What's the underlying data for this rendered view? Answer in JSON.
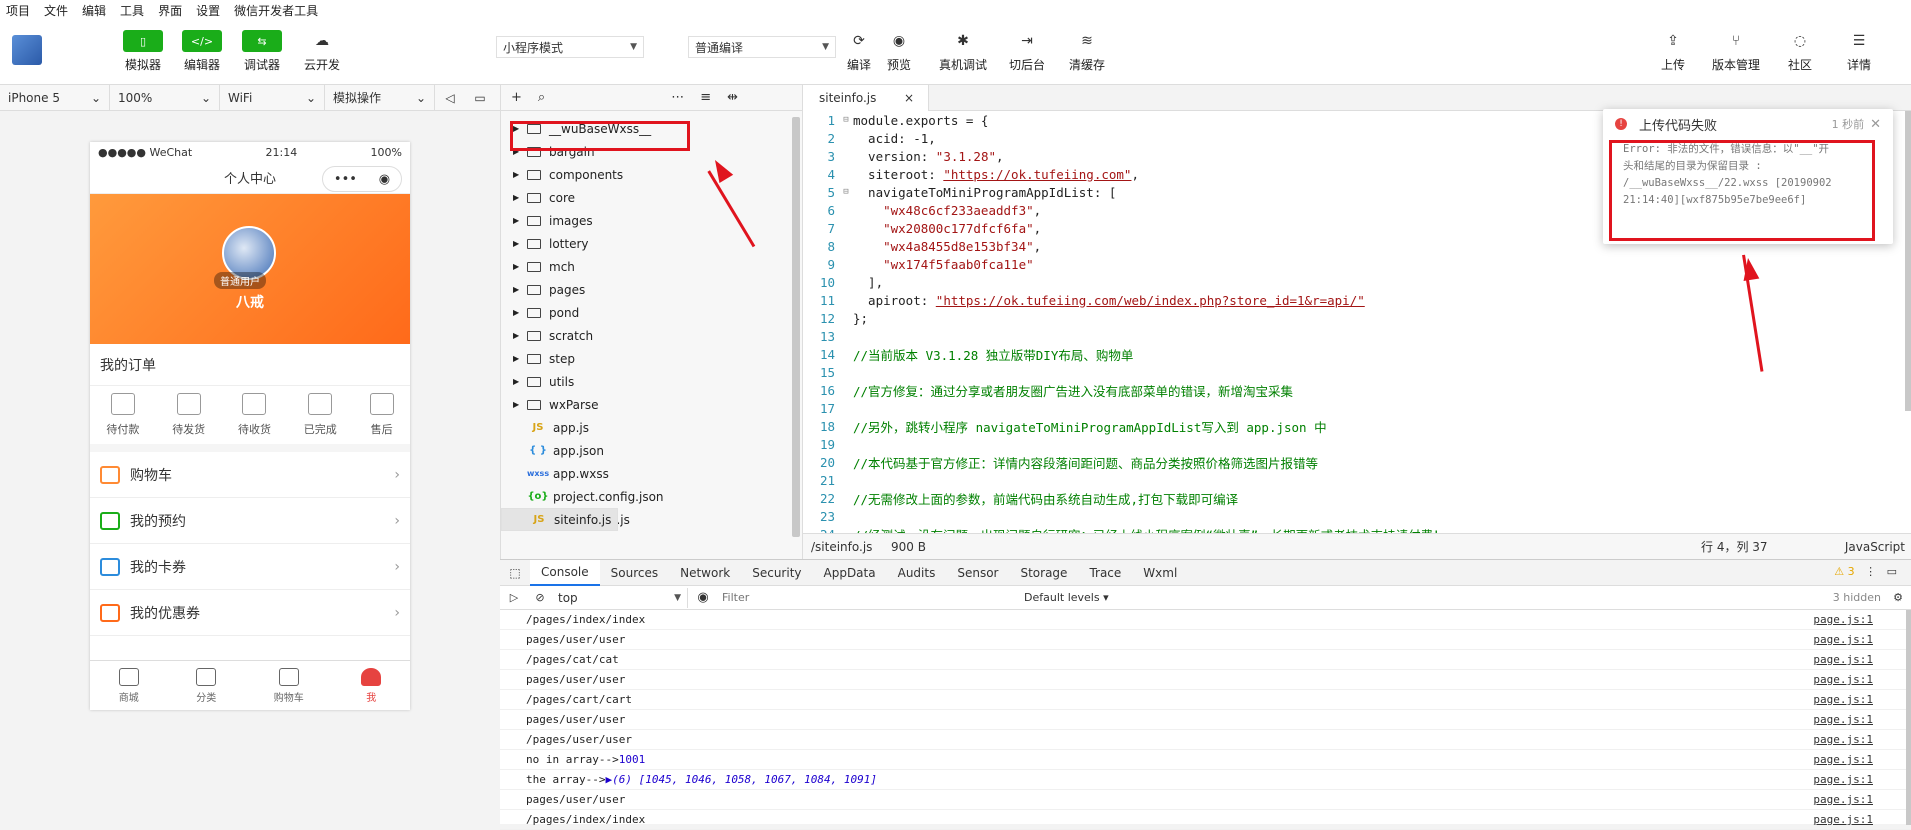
{
  "menubar": [
    "项目",
    "文件",
    "编辑",
    "工具",
    "界面",
    "设置",
    "微信开发者工具"
  ],
  "toolbar": {
    "simulator": "模拟器",
    "editor": "编辑器",
    "debugger": "调试器",
    "cloud": "云开发",
    "mode": "小程序模式",
    "compile_mode": "普通编译",
    "compile": "编译",
    "preview": "预览",
    "remote_debug": "真机调试",
    "background": "切后台",
    "clear_cache": "清缓存",
    "upload": "上传",
    "version": "版本管理",
    "community": "社区",
    "details": "详情"
  },
  "devbar": {
    "device": "iPhone 5",
    "zoom": "100%",
    "network": "WiFi",
    "action": "模拟操作"
  },
  "phone": {
    "carrier": "●●●●● WeChat",
    "time": "21:14",
    "battery": "100%",
    "nav_title": "个人中心",
    "capsule_dots": "•••",
    "capsule_close": "◉",
    "user_badge": "普通用户",
    "user_name": "八戒",
    "orders_title": "我的订单",
    "orders": [
      "待付款",
      "待发货",
      "待收货",
      "已完成",
      "售后"
    ],
    "list": [
      "购物车",
      "我的预约",
      "我的卡券",
      "我的优惠券"
    ],
    "tabs": [
      "商城",
      "分类",
      "购物车",
      "我"
    ]
  },
  "explorer": {
    "tools": [
      "+",
      "⌕",
      "⋯",
      "≡",
      "⇹"
    ],
    "folders": [
      "__wuBaseWxss__",
      "bargain",
      "components",
      "core",
      "images",
      "lottery",
      "mch",
      "pages",
      "pond",
      "scratch",
      "step",
      "utils",
      "wxParse"
    ],
    "files": [
      {
        "icon": "JS",
        "name": "app.js",
        "kind": "js"
      },
      {
        "icon": "{ }",
        "name": "app.json",
        "kind": "json"
      },
      {
        "icon": "wxss",
        "name": "app.wxss",
        "kind": "wxss"
      },
      {
        "icon": "{o}",
        "name": "project.config.json",
        "kind": "cfg"
      },
      {
        "icon": "JS",
        "name": "siteinfo.js",
        "kind": "js"
      },
      {
        "icon": "JS",
        "name": "siteinfo.tpl.js",
        "kind": "js"
      }
    ]
  },
  "editor": {
    "tab": "siteinfo.js",
    "tab_close": "×",
    "lines": [
      {
        "n": "1",
        "f": "⊟",
        "parts": [
          [
            "k",
            "module.exports = {"
          ]
        ]
      },
      {
        "n": "2",
        "f": "",
        "parts": [
          [
            "k",
            "  acid: -1,"
          ]
        ]
      },
      {
        "n": "3",
        "f": "",
        "parts": [
          [
            "k",
            "  version: "
          ],
          [
            "s",
            "\"3.1.28\""
          ],
          [
            "k",
            ","
          ]
        ]
      },
      {
        "n": "4",
        "f": "",
        "parts": [
          [
            "k",
            "  siteroot: "
          ],
          [
            "u",
            "\"https://ok.tufeiing.com\""
          ],
          [
            "k",
            ","
          ]
        ]
      },
      {
        "n": "5",
        "f": "⊟",
        "parts": [
          [
            "k",
            "  navigateToMiniProgramAppIdList: ["
          ]
        ]
      },
      {
        "n": "6",
        "f": "",
        "parts": [
          [
            "s",
            "    \"wx48c6cf233aeaddf3\""
          ],
          [
            "k",
            ","
          ]
        ]
      },
      {
        "n": "7",
        "f": "",
        "parts": [
          [
            "s",
            "    \"wx20800c177dfcf6fa\""
          ],
          [
            "k",
            ","
          ]
        ]
      },
      {
        "n": "8",
        "f": "",
        "parts": [
          [
            "s",
            "    \"wx4a8455d8e153bf34\""
          ],
          [
            "k",
            ","
          ]
        ]
      },
      {
        "n": "9",
        "f": "",
        "parts": [
          [
            "s",
            "    \"wx174f5faab0fca11e\""
          ]
        ]
      },
      {
        "n": "10",
        "f": "",
        "parts": [
          [
            "k",
            "  ],"
          ]
        ]
      },
      {
        "n": "11",
        "f": "",
        "parts": [
          [
            "k",
            "  apiroot: "
          ],
          [
            "u",
            "\"https://ok.tufeiing.com/web/index.php?store_id=1&r=api/\""
          ]
        ]
      },
      {
        "n": "12",
        "f": "",
        "parts": [
          [
            "k",
            "};"
          ]
        ]
      },
      {
        "n": "13",
        "f": "",
        "parts": []
      },
      {
        "n": "14",
        "f": "",
        "parts": [
          [
            "c",
            "//当前版本 V3.1.28 独立版带DIY布局、购物单"
          ]
        ]
      },
      {
        "n": "15",
        "f": "",
        "parts": []
      },
      {
        "n": "16",
        "f": "",
        "parts": [
          [
            "c",
            "//官方修复：通过分享或者朋友圈广告进入没有底部菜单的错误，新增淘宝采集"
          ]
        ]
      },
      {
        "n": "17",
        "f": "",
        "parts": []
      },
      {
        "n": "18",
        "f": "",
        "parts": [
          [
            "c",
            "//另外，跳转小程序 navigateToMiniProgramAppIdList写入到 app.json 中"
          ]
        ]
      },
      {
        "n": "19",
        "f": "",
        "parts": []
      },
      {
        "n": "20",
        "f": "",
        "parts": [
          [
            "c",
            "//本代码基于官方修正：详情内容段落间距问题、商品分类按照价格筛选图片报错等"
          ]
        ]
      },
      {
        "n": "21",
        "f": "",
        "parts": []
      },
      {
        "n": "22",
        "f": "",
        "parts": [
          [
            "c",
            "//无需修改上面的参数，前端代码由系统自动生成,打包下载即可编译"
          ]
        ]
      },
      {
        "n": "23",
        "f": "",
        "parts": []
      },
      {
        "n": "24",
        "f": "",
        "parts": [
          [
            "c",
            "//经测试，没有问题，出现问题自行研究；已经上线小程序案例“微壮喜”，长期更新或者技术支持请付费！"
          ]
        ]
      }
    ],
    "status_path": "/siteinfo.js",
    "status_size": "900 B",
    "status_pos": "行 4，列 37",
    "status_lang": "JavaScript"
  },
  "console": {
    "tabs": [
      "Console",
      "Sources",
      "Network",
      "Security",
      "AppData",
      "Audits",
      "Sensor",
      "Storage",
      "Trace",
      "Wxml"
    ],
    "warn": "⚠ 3",
    "context": "top",
    "filter_placeholder": "Filter",
    "levels": "Default levels ▾",
    "hidden": "3 hidden",
    "src": "page.js:1",
    "lines": [
      {
        "t": "/pages/index/index"
      },
      {
        "t": "pages/user/user"
      },
      {
        "t": "/pages/cat/cat"
      },
      {
        "t": "pages/user/user"
      },
      {
        "t": "/pages/cart/cart"
      },
      {
        "t": "pages/user/user"
      },
      {
        "t": "/pages/user/user"
      },
      {
        "t": "no in array--> ",
        "num": "1001"
      },
      {
        "t": "the array--> ",
        "arr": "▶(6) [1045, 1046, 1058, 1067, 1084, 1091]"
      },
      {
        "t": "pages/user/user"
      },
      {
        "t": "/pages/index/index"
      }
    ]
  },
  "toast": {
    "title": "上传代码失败",
    "time": "1 秒前",
    "body": [
      "Error: 非法的文件，错误信息：以\"__\"开",
      "头和结尾的目录为保留目录 :",
      "/__wuBaseWxss__/22.wxss [20190902",
      "21:14:40][wxf875b95e7be9ee6f]"
    ]
  },
  "colors": {
    "wechat_green": "#1aad19",
    "annotation_red": "#e0141e",
    "error_red": "#e64340"
  }
}
